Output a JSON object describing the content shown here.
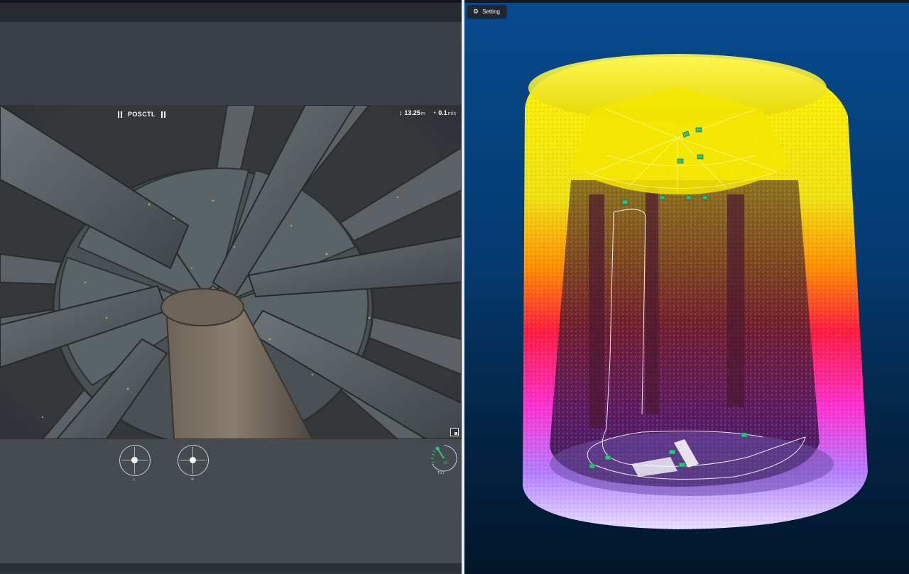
{
  "camera": {
    "flight_mode": "POSCTL",
    "altitude_value": "13.25",
    "altitude_unit": "m",
    "speed_value": "0.1",
    "speed_unit": "m/s"
  },
  "controls": {
    "left_joystick_label": "L",
    "right_joystick_label": "R",
    "tilt_label": "TILT",
    "tilt_value": "30°"
  },
  "pointcloud": {
    "setting_label": "Setting"
  },
  "colors": {
    "accent_green": "#2ec27e",
    "cloud_yellow": "#fff200",
    "cloud_red": "#ff1a3c",
    "cloud_magenta": "#ff2fd0",
    "cloud_lavender": "#d8c8ff"
  },
  "icons": {
    "mode_left": "bars-icon",
    "mode_right": "bars-icon",
    "altitude": "altitude-arrow-icon",
    "speed": "speedometer-icon",
    "setting": "gear-icon",
    "fullscreen": "expand-icon"
  }
}
